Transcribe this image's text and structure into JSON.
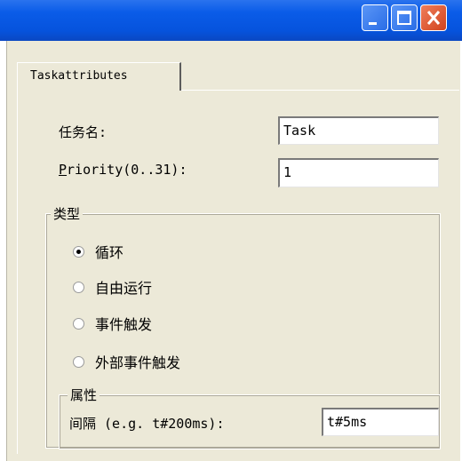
{
  "window": {
    "minimize_label": "minimize",
    "maximize_label": "maximize",
    "close_label": "close"
  },
  "tab": {
    "label": "Taskattributes"
  },
  "form": {
    "task_name_label": "任务名:",
    "task_name_value": "Task",
    "priority_label_first": "P",
    "priority_label_rest": "riority(0..31):",
    "priority_value": "1"
  },
  "type_group": {
    "title": "类型",
    "options": [
      {
        "label": "循环",
        "selected": true
      },
      {
        "label": "自由运行",
        "selected": false
      },
      {
        "label": "事件触发",
        "selected": false
      },
      {
        "label": "外部事件触发",
        "selected": false
      }
    ]
  },
  "properties_group": {
    "title": "属性",
    "interval_label": "间隔 (e.g. t#200ms):",
    "interval_value": "t#5ms"
  }
}
